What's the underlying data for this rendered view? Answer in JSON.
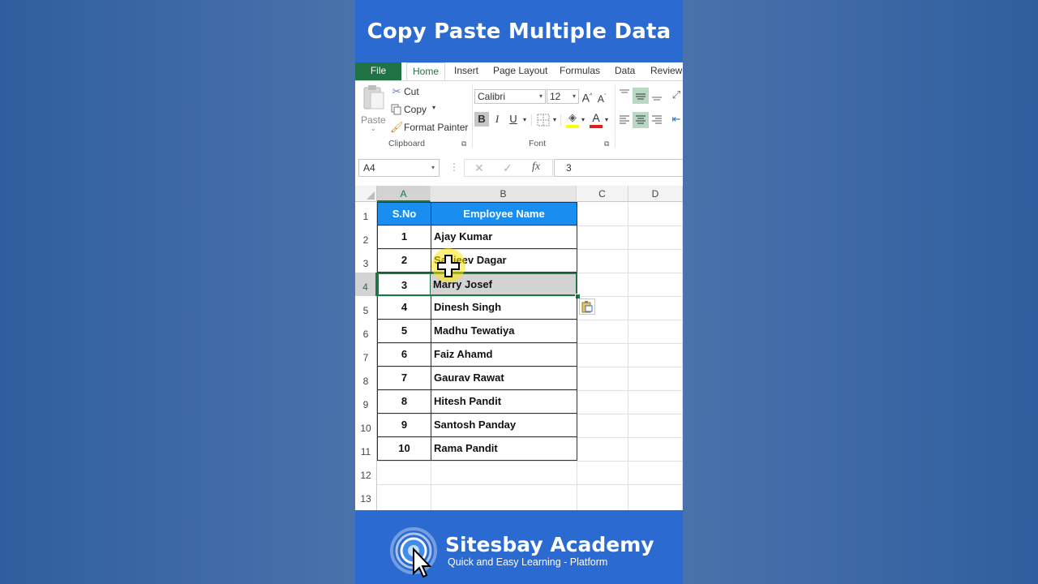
{
  "title": "Copy Paste Multiple Data",
  "ribbon": {
    "tabs": [
      "File",
      "Home",
      "Insert",
      "Page Layout",
      "Formulas",
      "Data",
      "Review"
    ],
    "clipboard": {
      "paste_label": "Paste",
      "cut_label": "Cut",
      "copy_label": "Copy",
      "format_painter_label": "Format Painter",
      "group_label": "Clipboard"
    },
    "font": {
      "font_name": "Calibri",
      "font_size": "12",
      "bold_label": "B",
      "italic_label": "I",
      "underline_label": "U",
      "group_label": "Font",
      "fill_color": "#ffff00",
      "font_color": "#e0201c"
    }
  },
  "formula_bar": {
    "name_box": "A4",
    "fx_label": "fx",
    "formula": "3"
  },
  "sheet": {
    "columns": [
      "A",
      "B",
      "C",
      "D"
    ],
    "selected_column": "A",
    "rows": [
      "1",
      "2",
      "3",
      "4",
      "5",
      "6",
      "7",
      "8",
      "9",
      "10",
      "11",
      "12",
      "13"
    ],
    "selected_row": "4",
    "header": {
      "sno": "S.No",
      "name": "Employee Name"
    },
    "header_color": "#1a8ef0",
    "data": [
      {
        "sno": "1",
        "name": "Ajay Kumar"
      },
      {
        "sno": "2",
        "name": "Sanjeev Dagar"
      },
      {
        "sno": "3",
        "name": "Marry Josef"
      },
      {
        "sno": "4",
        "name": "Dinesh Singh"
      },
      {
        "sno": "5",
        "name": "Madhu Tewatiya"
      },
      {
        "sno": "6",
        "name": "Faiz Ahamd"
      },
      {
        "sno": "7",
        "name": "Gaurav Rawat"
      },
      {
        "sno": "8",
        "name": "Hitesh Pandit"
      },
      {
        "sno": "9",
        "name": "Santosh Panday"
      },
      {
        "sno": "10",
        "name": "Rama Pandit"
      }
    ],
    "selected_data_row": "3"
  },
  "brand": {
    "name": "Sitesbay Academy",
    "tagline": "Quick and Easy Learning - Platform"
  },
  "colors": {
    "excel_green": "#217346",
    "title_blue": "#2b6bd1",
    "selection_gray": "#d3d3d3"
  }
}
